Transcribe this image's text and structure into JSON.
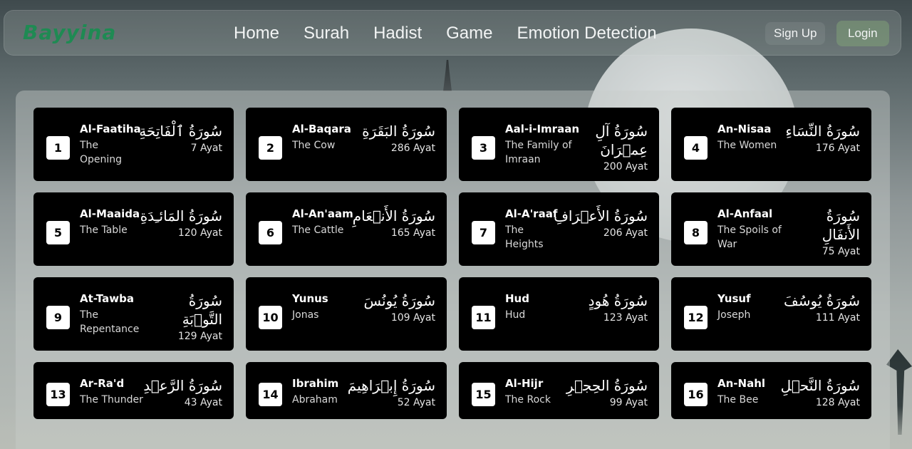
{
  "brand": {
    "logo": "Bayyina"
  },
  "nav": {
    "links": [
      "Home",
      "Surah",
      "Hadist",
      "Game",
      "Emotion Detection"
    ],
    "signup": "Sign Up",
    "login": "Login"
  },
  "surahs": [
    {
      "number": "1",
      "latin": "Al-Faatiha",
      "meaning": "The Opening",
      "arabic": "سُورَةُ ٱلْفَاتِحَةِ",
      "ayat": "7 Ayat"
    },
    {
      "number": "2",
      "latin": "Al-Baqara",
      "meaning": "The Cow",
      "arabic": "سُورَةُ البَقَرَةِ",
      "ayat": "286 Ayat"
    },
    {
      "number": "3",
      "latin": "Aal-i-Imraan",
      "meaning": "The Family of Imraan",
      "arabic": "سُورَةُ آلِ عِمۡرَانَ",
      "ayat": "200 Ayat"
    },
    {
      "number": "4",
      "latin": "An-Nisaa",
      "meaning": "The Women",
      "arabic": "سُورَةُ النِّسَاءِ",
      "ayat": "176 Ayat"
    },
    {
      "number": "5",
      "latin": "Al-Maaida",
      "meaning": "The Table",
      "arabic": "سُورَةُ المَائـِدَةِ",
      "ayat": "120 Ayat"
    },
    {
      "number": "6",
      "latin": "Al-An'aam",
      "meaning": "The Cattle",
      "arabic": "سُورَةُ الأَنۡعَامِ",
      "ayat": "165 Ayat"
    },
    {
      "number": "7",
      "latin": "Al-A'raaf",
      "meaning": "The Heights",
      "arabic": "سُورَةُ الأَعۡرَافِ",
      "ayat": "206 Ayat"
    },
    {
      "number": "8",
      "latin": "Al-Anfaal",
      "meaning": "The Spoils of War",
      "arabic": "سُورَةُ الأَنفَالِ",
      "ayat": "75 Ayat"
    },
    {
      "number": "9",
      "latin": "At-Tawba",
      "meaning": "The Repentance",
      "arabic": "سُورَةُ التَّوۡبَةِ",
      "ayat": "129 Ayat"
    },
    {
      "number": "10",
      "latin": "Yunus",
      "meaning": "Jonas",
      "arabic": "سُورَةُ يُونُسَ",
      "ayat": "109 Ayat"
    },
    {
      "number": "11",
      "latin": "Hud",
      "meaning": "Hud",
      "arabic": "سُورَةُ هُودٍ",
      "ayat": "123 Ayat"
    },
    {
      "number": "12",
      "latin": "Yusuf",
      "meaning": "Joseph",
      "arabic": "سُورَةُ يُوسُفَ",
      "ayat": "111 Ayat"
    },
    {
      "number": "13",
      "latin": "Ar-Ra'd",
      "meaning": "The Thunder",
      "arabic": "سُورَةُ الرَّعۡدِ",
      "ayat": "43 Ayat"
    },
    {
      "number": "14",
      "latin": "Ibrahim",
      "meaning": "Abraham",
      "arabic": "سُورَةُ إِبۡرَاهِيمَ",
      "ayat": "52 Ayat"
    },
    {
      "number": "15",
      "latin": "Al-Hijr",
      "meaning": "The Rock",
      "arabic": "سُورَةُ الحِجۡرِ",
      "ayat": "99 Ayat"
    },
    {
      "number": "16",
      "latin": "An-Nahl",
      "meaning": "The Bee",
      "arabic": "سُورَةُ النَّحۡلِ",
      "ayat": "128 Ayat"
    }
  ]
}
